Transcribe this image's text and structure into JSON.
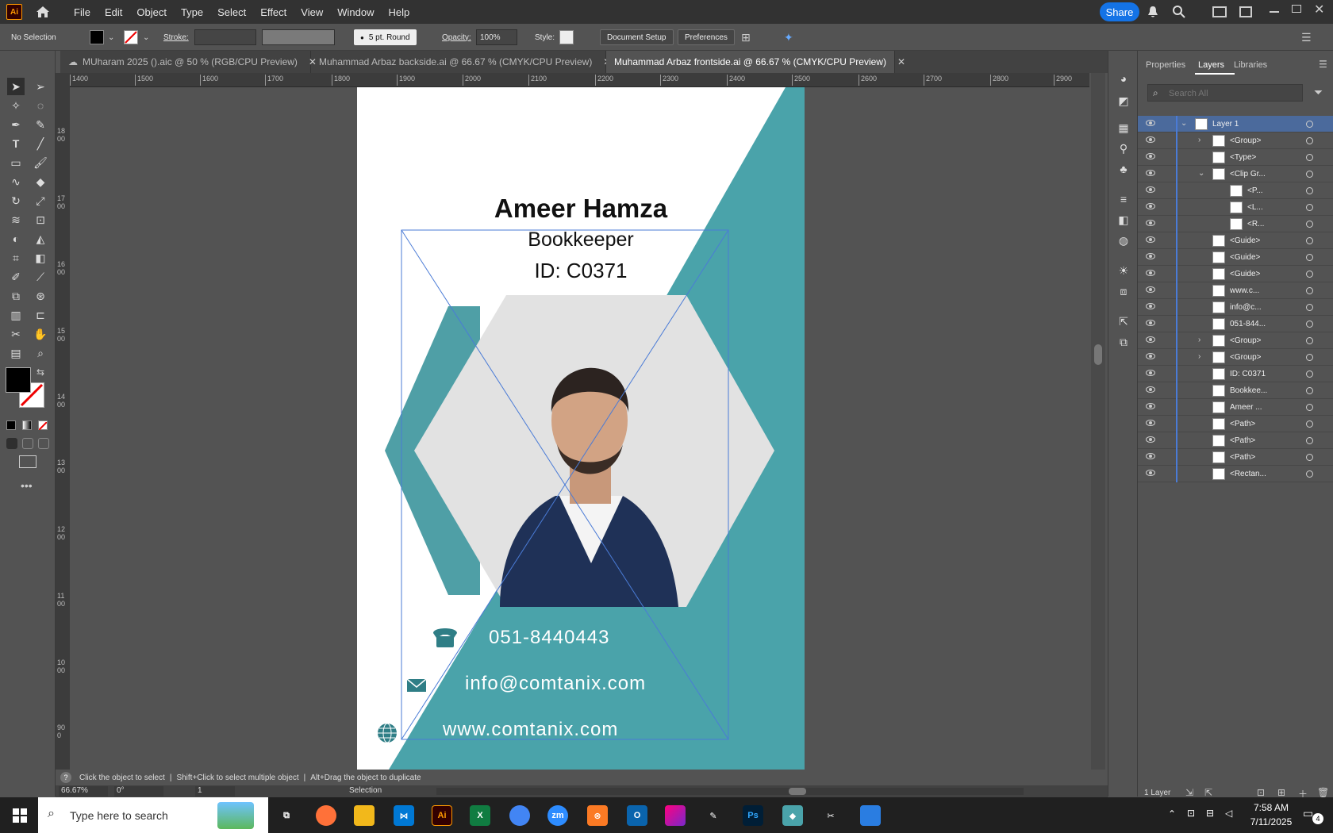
{
  "menubar": {
    "app_logo": "Ai",
    "items": [
      "File",
      "Edit",
      "Object",
      "Type",
      "Select",
      "Effect",
      "View",
      "Window",
      "Help"
    ],
    "share_label": "Share"
  },
  "controlbar": {
    "selection": "No Selection",
    "stroke_label": "Stroke:",
    "brush": "5 pt. Round",
    "opacity_label": "Opacity:",
    "opacity_value": "100%",
    "style_label": "Style:",
    "document_setup": "Document Setup",
    "preferences": "Preferences"
  },
  "tabs": [
    {
      "label": "MUharam 2025 ().aic @ 50 % (RGB/CPU Preview)",
      "active": false
    },
    {
      "label": "Muhammad Arbaz backside.ai @ 66.67 % (CMYK/CPU Preview)",
      "active": false
    },
    {
      "label": "Muhammad Arbaz frontside.ai @ 66.67 % (CMYK/CPU Preview)",
      "active": true
    }
  ],
  "ruler": {
    "h_ticks": [
      "1400",
      "1500",
      "1600",
      "1700",
      "1800",
      "1900",
      "2000",
      "2100",
      "2200",
      "2300",
      "2400",
      "2500",
      "2600",
      "2700",
      "2800",
      "2900"
    ],
    "v_ticks": [
      "1800",
      "1700",
      "1600",
      "1500",
      "1400",
      "1300",
      "1200",
      "1100",
      "1000",
      "900",
      "800"
    ]
  },
  "card": {
    "name": "Ameer Hamza",
    "role": "Bookkeeper",
    "id": "ID: C0371",
    "phone": "051-8440443",
    "email": "info@comtanix.com",
    "website": "www.comtanix.com",
    "accent_color": "#4aa3aa",
    "hex_gray": "#e2e2e2"
  },
  "panel": {
    "tabs": [
      "Properties",
      "Layers",
      "Libraries"
    ],
    "search_placeholder": "Search All",
    "layers": [
      {
        "name": "Layer 1",
        "indent": 0,
        "arrow": "v",
        "selected": true
      },
      {
        "name": "<Group>",
        "indent": 1,
        "arrow": ">"
      },
      {
        "name": "<Type>",
        "indent": 1,
        "arrow": ""
      },
      {
        "name": "<Clip Gr...",
        "indent": 1,
        "arrow": "v"
      },
      {
        "name": "<P...",
        "indent": 2,
        "arrow": ""
      },
      {
        "name": "<L...",
        "indent": 2,
        "arrow": ""
      },
      {
        "name": "<R...",
        "indent": 2,
        "arrow": ""
      },
      {
        "name": "<Guide>",
        "indent": 1,
        "arrow": ""
      },
      {
        "name": "<Guide>",
        "indent": 1,
        "arrow": ""
      },
      {
        "name": "<Guide>",
        "indent": 1,
        "arrow": ""
      },
      {
        "name": "www.c...",
        "indent": 1,
        "arrow": ""
      },
      {
        "name": "info@c...",
        "indent": 1,
        "arrow": ""
      },
      {
        "name": "051-844...",
        "indent": 1,
        "arrow": ""
      },
      {
        "name": "<Group>",
        "indent": 1,
        "arrow": ">"
      },
      {
        "name": "<Group>",
        "indent": 1,
        "arrow": ">"
      },
      {
        "name": "ID: C0371",
        "indent": 1,
        "arrow": ""
      },
      {
        "name": "Bookkee...",
        "indent": 1,
        "arrow": ""
      },
      {
        "name": "Ameer ...",
        "indent": 1,
        "arrow": ""
      },
      {
        "name": "<Path>",
        "indent": 1,
        "arrow": ""
      },
      {
        "name": "<Path>",
        "indent": 1,
        "arrow": ""
      },
      {
        "name": "<Path>",
        "indent": 1,
        "arrow": ""
      },
      {
        "name": "<Rectan...",
        "indent": 1,
        "arrow": ""
      }
    ],
    "footer": "1 Layer"
  },
  "hint": {
    "text1": "Click the object to select",
    "text2": "Shift+Click to select multiple object",
    "text3": "Alt+Drag the object to duplicate"
  },
  "status": {
    "zoom": "66.67%",
    "rotation": "0°",
    "artboard": "1",
    "tool": "Selection"
  },
  "taskbar": {
    "search_placeholder": "Type here to search",
    "time": "7:58 AM",
    "date": "7/11/2025",
    "notifications": "4"
  }
}
